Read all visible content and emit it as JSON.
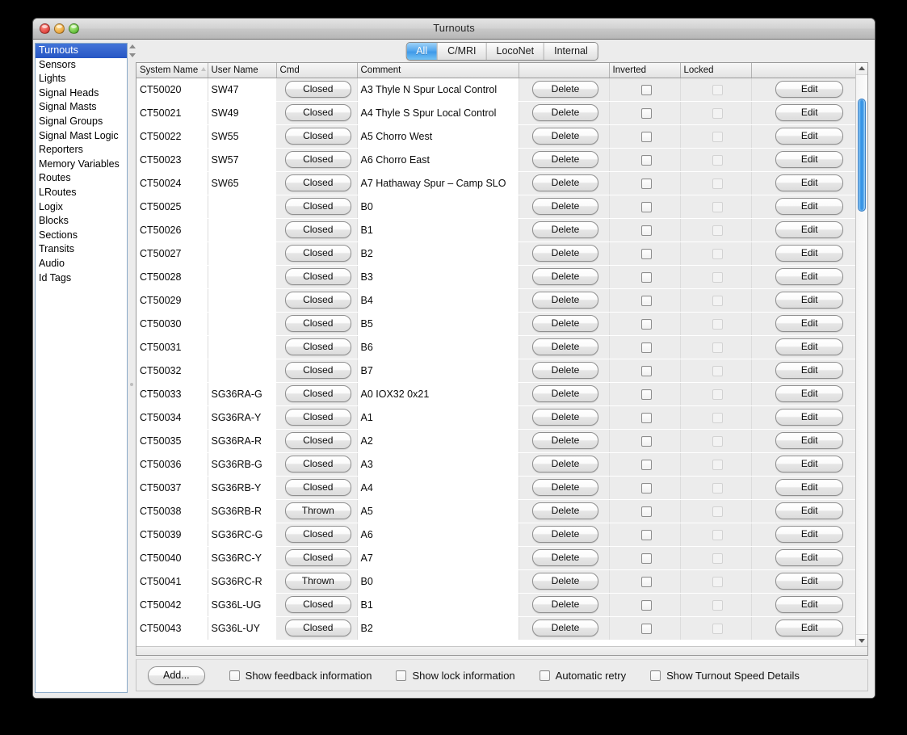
{
  "window": {
    "title": "Turnouts",
    "controls": [
      "close-button",
      "minimize-button",
      "maximize-button"
    ]
  },
  "sidebar": {
    "items": [
      {
        "label": "Turnouts",
        "selected": true
      },
      {
        "label": "Sensors",
        "selected": false
      },
      {
        "label": "Lights",
        "selected": false
      },
      {
        "label": "Signal Heads",
        "selected": false
      },
      {
        "label": "Signal Masts",
        "selected": false
      },
      {
        "label": "Signal Groups",
        "selected": false
      },
      {
        "label": "Signal Mast Logic",
        "selected": false
      },
      {
        "label": "Reporters",
        "selected": false
      },
      {
        "label": "Memory Variables",
        "selected": false
      },
      {
        "label": "Routes",
        "selected": false
      },
      {
        "label": "LRoutes",
        "selected": false
      },
      {
        "label": "Logix",
        "selected": false
      },
      {
        "label": "Blocks",
        "selected": false
      },
      {
        "label": "Sections",
        "selected": false
      },
      {
        "label": "Transits",
        "selected": false
      },
      {
        "label": "Audio",
        "selected": false
      },
      {
        "label": "Id Tags",
        "selected": false
      }
    ]
  },
  "tabs": [
    {
      "label": "All",
      "active": true
    },
    {
      "label": "C/MRI",
      "active": false
    },
    {
      "label": "LocoNet",
      "active": false
    },
    {
      "label": "Internal",
      "active": false
    }
  ],
  "table": {
    "columns": [
      {
        "label": "System Name",
        "sorted": "asc"
      },
      {
        "label": "User Name"
      },
      {
        "label": "Cmd"
      },
      {
        "label": "Comment"
      },
      {
        "label": ""
      },
      {
        "label": "Inverted"
      },
      {
        "label": "Locked"
      },
      {
        "label": ""
      }
    ],
    "delete_label": "Delete",
    "edit_label": "Edit",
    "rows": [
      {
        "system": "CT50020",
        "user": "SW47",
        "cmd": "Closed",
        "comment": "A3 Thyle N Spur Local Control",
        "inverted": false,
        "locked": false
      },
      {
        "system": "CT50021",
        "user": "SW49",
        "cmd": "Closed",
        "comment": "A4 Thyle S Spur Local Control",
        "inverted": false,
        "locked": false
      },
      {
        "system": "CT50022",
        "user": "SW55",
        "cmd": "Closed",
        "comment": "A5 Chorro West",
        "inverted": false,
        "locked": false
      },
      {
        "system": "CT50023",
        "user": "SW57",
        "cmd": "Closed",
        "comment": "A6 Chorro East",
        "inverted": false,
        "locked": false
      },
      {
        "system": "CT50024",
        "user": "SW65",
        "cmd": "Closed",
        "comment": "A7 Hathaway Spur – Camp SLO",
        "inverted": false,
        "locked": false
      },
      {
        "system": "CT50025",
        "user": "",
        "cmd": "Closed",
        "comment": "B0",
        "inverted": false,
        "locked": false
      },
      {
        "system": "CT50026",
        "user": "",
        "cmd": "Closed",
        "comment": "B1",
        "inverted": false,
        "locked": false
      },
      {
        "system": "CT50027",
        "user": "",
        "cmd": "Closed",
        "comment": "B2",
        "inverted": false,
        "locked": false
      },
      {
        "system": "CT50028",
        "user": "",
        "cmd": "Closed",
        "comment": "B3",
        "inverted": false,
        "locked": false
      },
      {
        "system": "CT50029",
        "user": "",
        "cmd": "Closed",
        "comment": "B4",
        "inverted": false,
        "locked": false
      },
      {
        "system": "CT50030",
        "user": "",
        "cmd": "Closed",
        "comment": "B5",
        "inverted": false,
        "locked": false
      },
      {
        "system": "CT50031",
        "user": "",
        "cmd": "Closed",
        "comment": "B6",
        "inverted": false,
        "locked": false
      },
      {
        "system": "CT50032",
        "user": "",
        "cmd": "Closed",
        "comment": "B7",
        "inverted": false,
        "locked": false
      },
      {
        "system": "CT50033",
        "user": "SG36RA-G",
        "cmd": "Closed",
        "comment": "A0 IOX32 0x21",
        "inverted": false,
        "locked": false
      },
      {
        "system": "CT50034",
        "user": "SG36RA-Y",
        "cmd": "Closed",
        "comment": "A1",
        "inverted": false,
        "locked": false
      },
      {
        "system": "CT50035",
        "user": "SG36RA-R",
        "cmd": "Closed",
        "comment": "A2",
        "inverted": false,
        "locked": false
      },
      {
        "system": "CT50036",
        "user": "SG36RB-G",
        "cmd": "Closed",
        "comment": "A3",
        "inverted": false,
        "locked": false
      },
      {
        "system": "CT50037",
        "user": "SG36RB-Y",
        "cmd": "Closed",
        "comment": "A4",
        "inverted": false,
        "locked": false
      },
      {
        "system": "CT50038",
        "user": "SG36RB-R",
        "cmd": "Thrown",
        "comment": "A5",
        "inverted": false,
        "locked": false
      },
      {
        "system": "CT50039",
        "user": "SG36RC-G",
        "cmd": "Closed",
        "comment": "A6",
        "inverted": false,
        "locked": false
      },
      {
        "system": "CT50040",
        "user": "SG36RC-Y",
        "cmd": "Closed",
        "comment": "A7",
        "inverted": false,
        "locked": false
      },
      {
        "system": "CT50041",
        "user": "SG36RC-R",
        "cmd": "Thrown",
        "comment": "B0",
        "inverted": false,
        "locked": false
      },
      {
        "system": "CT50042",
        "user": "SG36L-UG",
        "cmd": "Closed",
        "comment": "B1",
        "inverted": false,
        "locked": false
      },
      {
        "system": "CT50043",
        "user": "SG36L-UY",
        "cmd": "Closed",
        "comment": "B2",
        "inverted": false,
        "locked": false
      }
    ]
  },
  "bottom": {
    "add_label": "Add...",
    "options": [
      {
        "label": "Show feedback information",
        "checked": false
      },
      {
        "label": "Show lock information",
        "checked": false
      },
      {
        "label": "Automatic retry",
        "checked": false
      },
      {
        "label": "Show Turnout Speed Details",
        "checked": false
      }
    ]
  },
  "colors": {
    "selection": "#2756c4",
    "tab_active": "#3f9ae9",
    "scrollbar_thumb": "#2f8fe3",
    "window_bg": "#ececec"
  }
}
